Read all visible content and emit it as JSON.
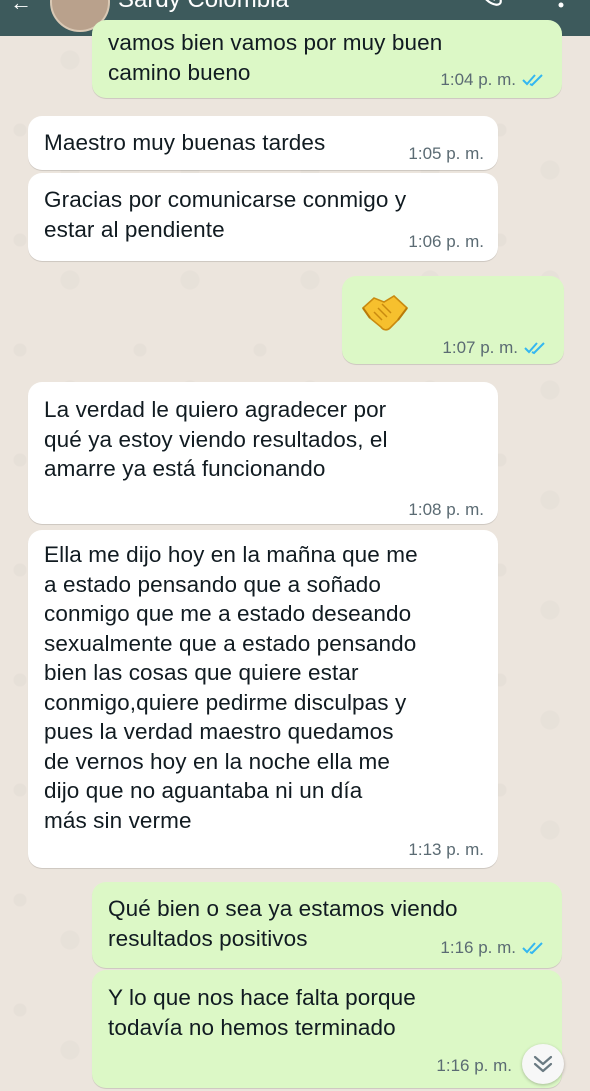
{
  "header": {
    "contact_name": "Sardy Colombia",
    "back_glyph": "←"
  },
  "messages": [
    {
      "direction": "outgoing",
      "text": "vamos bien vamos por muy buen\ncamino bueno",
      "time": "1:04 p. m.",
      "status": "read"
    },
    {
      "direction": "incoming",
      "text": "Maestro muy buenas tardes",
      "time": "1:05 p. m."
    },
    {
      "direction": "incoming",
      "text": "Gracias por comunicarse conmigo y\nestar al pendiente",
      "time": "1:06 p. m."
    },
    {
      "direction": "outgoing",
      "emoji": "handshake-emoji",
      "time": "1:07 p. m.",
      "status": "read"
    },
    {
      "direction": "incoming",
      "text": "La verdad le quiero agradecer por\nqué ya estoy viendo resultados, el\namarre ya está funcionando",
      "time": "1:08 p. m."
    },
    {
      "direction": "incoming",
      "text": "Ella me dijo hoy en la mañna que me\na estado pensando que a soñado\nconmigo que me a estado deseando\nsexualmente que a estado pensando\nbien las cosas que quiere estar\nconmigo,quiere pedirme disculpas y\npues la verdad maestro quedamos\nde vernos hoy en la noche ella me\ndijo que no aguantaba ni un día\nmás sin verme",
      "time": "1:13 p. m."
    },
    {
      "direction": "outgoing",
      "text": "Qué bien o sea ya estamos viendo\nresultados positivos",
      "time": "1:16 p. m.",
      "status": "read"
    },
    {
      "direction": "outgoing",
      "text": "Y lo que nos hace falta porque\ntodavía no hemos terminado",
      "time": "1:16 p. m.",
      "status": "sent"
    }
  ],
  "colors": {
    "outgoing_bubble": "#dcf8c6",
    "incoming_bubble": "#ffffff",
    "read_ticks": "#34b7f1",
    "chat_background": "#ece5dd",
    "header": "#3d5a5c"
  },
  "icons": {
    "read_receipt": "double-check-icon",
    "scroll_down": "double-chevron-down-icon",
    "call": "phone-icon",
    "menu": "kebab-menu-icon"
  }
}
